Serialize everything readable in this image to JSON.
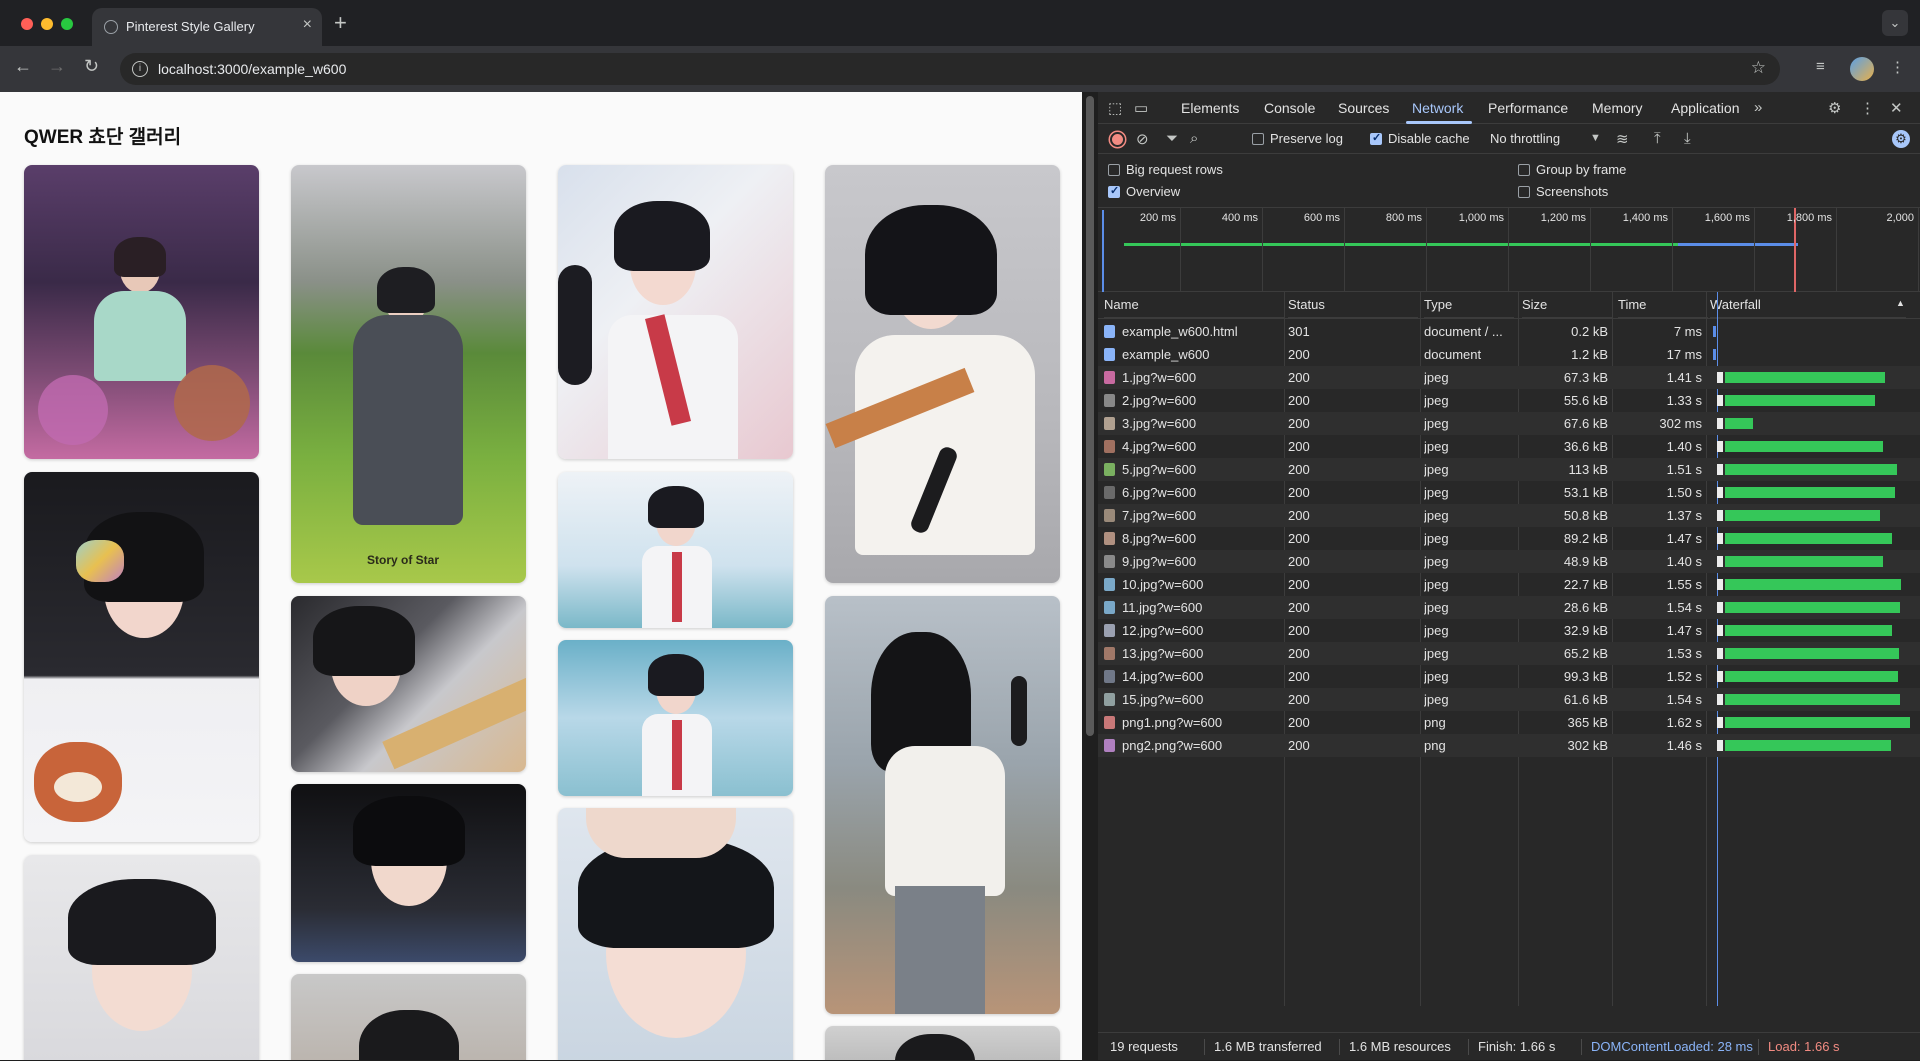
{
  "browser": {
    "tab_title": "Pinterest Style Gallery",
    "url": "localhost:3000/example_w600"
  },
  "page": {
    "title": "QWER 쵸단 갤러리",
    "watermark": "Story of Star"
  },
  "devtools": {
    "tabs": [
      "Elements",
      "Console",
      "Sources",
      "Network",
      "Performance",
      "Memory",
      "Application"
    ],
    "active_tab": "Network",
    "toolbar": {
      "preserve_log": "Preserve log",
      "preserve_log_checked": false,
      "disable_cache": "Disable cache",
      "disable_cache_checked": true,
      "throttling": "No throttling"
    },
    "options": {
      "big_request_rows": "Big request rows",
      "group_by_frame": "Group by frame",
      "overview": "Overview",
      "screenshots": "Screenshots"
    },
    "overview_ticks": [
      "200 ms",
      "400 ms",
      "600 ms",
      "800 ms",
      "1,000 ms",
      "1,200 ms",
      "1,400 ms",
      "1,600 ms",
      "1,800 ms",
      "2,000"
    ],
    "columns": {
      "name": "Name",
      "status": "Status",
      "type": "Type",
      "size": "Size",
      "time": "Time",
      "waterfall": "Waterfall"
    },
    "requests": [
      {
        "name": "example_w600.html",
        "status": "301",
        "type": "document / ...",
        "size": "0.2 kB",
        "time": "7 ms",
        "icon_color": "#8ab4f8",
        "wf_start_ms": 5,
        "wf_ms": 7
      },
      {
        "name": "example_w600",
        "status": "200",
        "type": "document",
        "size": "1.2 kB",
        "time": "17 ms",
        "icon_color": "#8ab4f8",
        "wf_start_ms": 12,
        "wf_ms": 17
      },
      {
        "name": "1.jpg?w=600",
        "status": "200",
        "type": "jpeg",
        "size": "67.3 kB",
        "time": "1.41 s",
        "icon_color": "#c86aa0",
        "wf_start_ms": 40,
        "wf_ms": 1410
      },
      {
        "name": "2.jpg?w=600",
        "status": "200",
        "type": "jpeg",
        "size": "55.6 kB",
        "time": "1.33 s",
        "icon_color": "#888888",
        "wf_start_ms": 40,
        "wf_ms": 1330
      },
      {
        "name": "3.jpg?w=600",
        "status": "200",
        "type": "jpeg",
        "size": "67.6 kB",
        "time": "302 ms",
        "icon_color": "#b0a090",
        "wf_start_ms": 40,
        "wf_ms": 302
      },
      {
        "name": "4.jpg?w=600",
        "status": "200",
        "type": "jpeg",
        "size": "36.6 kB",
        "time": "1.40 s",
        "icon_color": "#a07060",
        "wf_start_ms": 40,
        "wf_ms": 1400
      },
      {
        "name": "5.jpg?w=600",
        "status": "200",
        "type": "jpeg",
        "size": "113 kB",
        "time": "1.51 s",
        "icon_color": "#7ab060",
        "wf_start_ms": 40,
        "wf_ms": 1510
      },
      {
        "name": "6.jpg?w=600",
        "status": "200",
        "type": "jpeg",
        "size": "53.1 kB",
        "time": "1.50 s",
        "icon_color": "#6a6a6a",
        "wf_start_ms": 40,
        "wf_ms": 1500
      },
      {
        "name": "7.jpg?w=600",
        "status": "200",
        "type": "jpeg",
        "size": "50.8 kB",
        "time": "1.37 s",
        "icon_color": "#9a8a7a",
        "wf_start_ms": 40,
        "wf_ms": 1370
      },
      {
        "name": "8.jpg?w=600",
        "status": "200",
        "type": "jpeg",
        "size": "89.2 kB",
        "time": "1.47 s",
        "icon_color": "#b09080",
        "wf_start_ms": 40,
        "wf_ms": 1470
      },
      {
        "name": "9.jpg?w=600",
        "status": "200",
        "type": "jpeg",
        "size": "48.9 kB",
        "time": "1.40 s",
        "icon_color": "#8a8a8a",
        "wf_start_ms": 40,
        "wf_ms": 1400
      },
      {
        "name": "10.jpg?w=600",
        "status": "200",
        "type": "jpeg",
        "size": "22.7 kB",
        "time": "1.55 s",
        "icon_color": "#7aa8c8",
        "wf_start_ms": 40,
        "wf_ms": 1550
      },
      {
        "name": "11.jpg?w=600",
        "status": "200",
        "type": "jpeg",
        "size": "28.6 kB",
        "time": "1.54 s",
        "icon_color": "#7aa8c8",
        "wf_start_ms": 40,
        "wf_ms": 1540
      },
      {
        "name": "12.jpg?w=600",
        "status": "200",
        "type": "jpeg",
        "size": "32.9 kB",
        "time": "1.47 s",
        "icon_color": "#9aa0b0",
        "wf_start_ms": 40,
        "wf_ms": 1470
      },
      {
        "name": "13.jpg?w=600",
        "status": "200",
        "type": "jpeg",
        "size": "65.2 kB",
        "time": "1.53 s",
        "icon_color": "#a07868",
        "wf_start_ms": 40,
        "wf_ms": 1530
      },
      {
        "name": "14.jpg?w=600",
        "status": "200",
        "type": "jpeg",
        "size": "99.3 kB",
        "time": "1.52 s",
        "icon_color": "#707888",
        "wf_start_ms": 40,
        "wf_ms": 1520
      },
      {
        "name": "15.jpg?w=600",
        "status": "200",
        "type": "jpeg",
        "size": "61.6 kB",
        "time": "1.54 s",
        "icon_color": "#90a0a0",
        "wf_start_ms": 40,
        "wf_ms": 1540
      },
      {
        "name": "png1.png?w=600",
        "status": "200",
        "type": "png",
        "size": "365 kB",
        "time": "1.62 s",
        "icon_color": "#c87878",
        "wf_start_ms": 40,
        "wf_ms": 1620
      },
      {
        "name": "png2.png?w=600",
        "status": "200",
        "type": "png",
        "size": "302 kB",
        "time": "1.46 s",
        "icon_color": "#b080c0",
        "wf_start_ms": 40,
        "wf_ms": 1460
      }
    ],
    "status_bar": {
      "requests": "19 requests",
      "transferred": "1.6 MB transferred",
      "resources": "1.6 MB resources",
      "finish": "Finish: 1.66 s",
      "dom_content_loaded": "DOMContentLoaded: 28 ms",
      "load": "Load: 1.66 s"
    }
  }
}
